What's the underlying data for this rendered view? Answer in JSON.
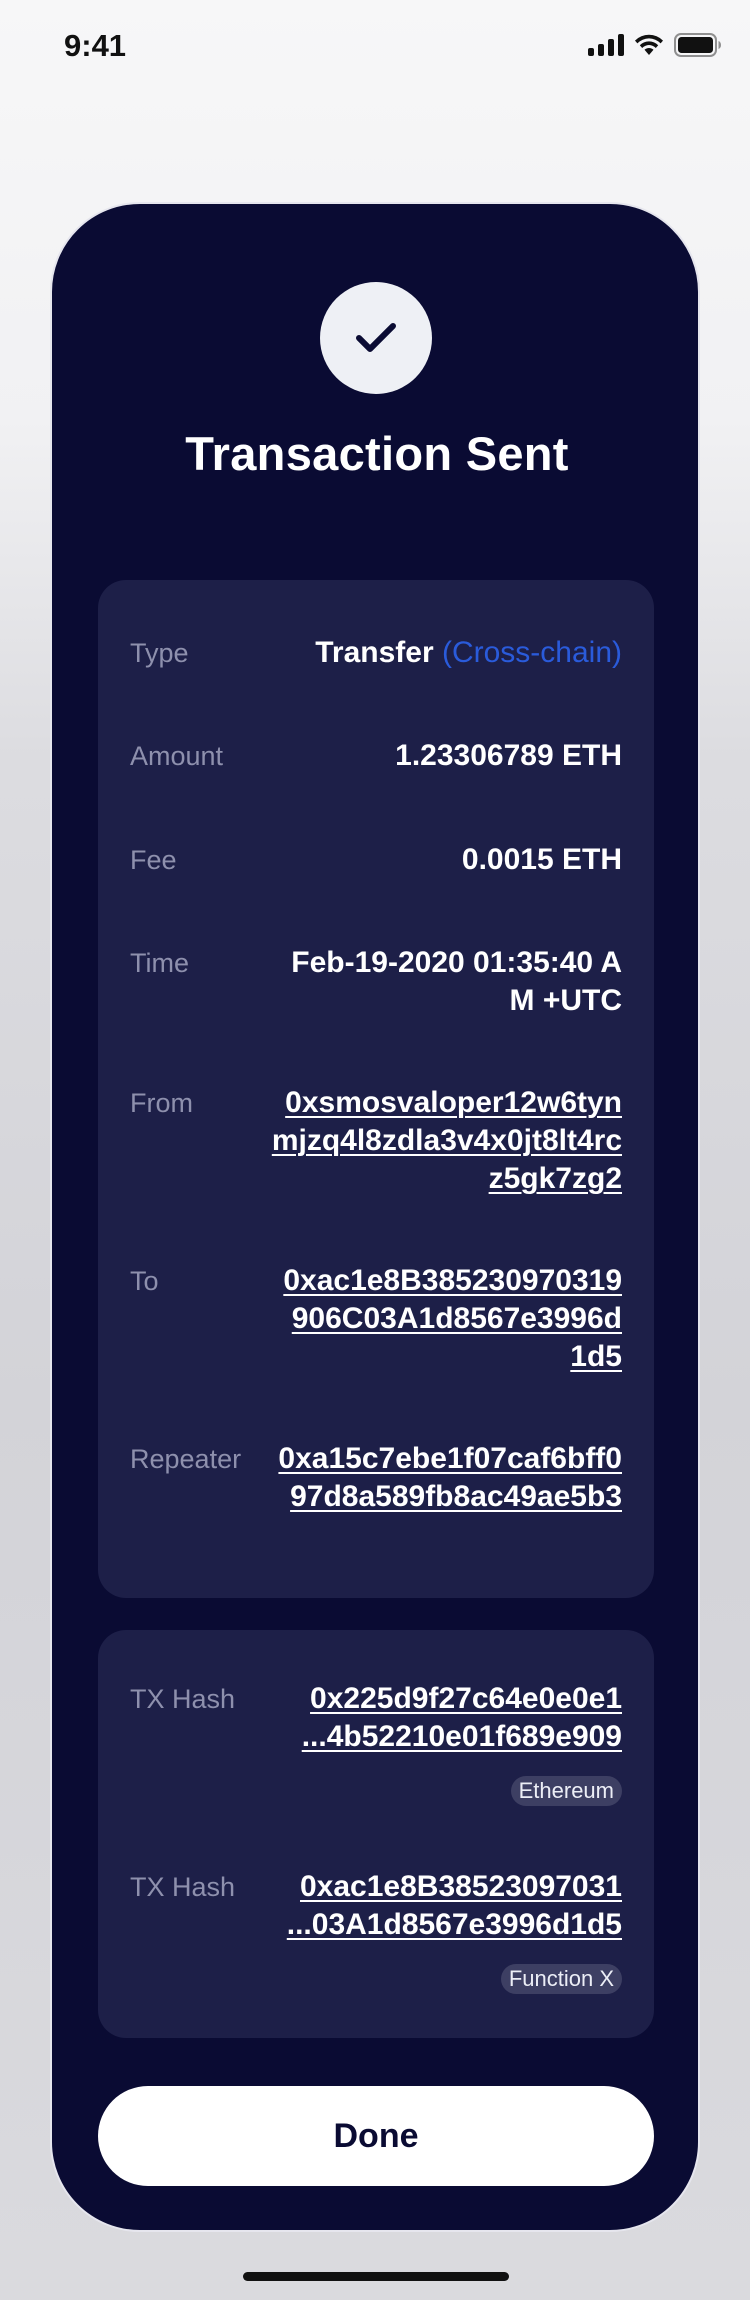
{
  "status_bar": {
    "time": "9:41"
  },
  "title": "Transaction Sent",
  "details": {
    "type": {
      "label": "Type",
      "value": "Transfer",
      "accent": "(Cross-chain)"
    },
    "amount": {
      "label": "Amount",
      "value": "1.23306789 ETH"
    },
    "fee": {
      "label": "Fee",
      "value": "0.0015 ETH"
    },
    "time": {
      "label": "Time",
      "value": "Feb-19-2020 01:35:40 AM +UTC"
    },
    "from": {
      "label": "From",
      "value": "0xsmosvaloper12w6tynmjzq4l8zdla3v4x0jt8lt4rcz5gk7zg2"
    },
    "to": {
      "label": "To",
      "value": "0xac1e8B385230970319906C03A1d8567e3996d1d5"
    },
    "repeater": {
      "label": "Repeater",
      "value": "0xa15c7ebe1f07caf6bff097d8a589fb8ac49ae5b3"
    }
  },
  "hashes": [
    {
      "label": "TX Hash",
      "line1": "0x225d9f27c64e0e0e1",
      "line2": "...4b52210e01f689e909",
      "network": "Ethereum"
    },
    {
      "label": "TX Hash",
      "line1": "0xac1e8B38523097031",
      "line2": "...03A1d8567e3996d1d5",
      "network": "Function X"
    }
  ],
  "done_label": "Done",
  "colors": {
    "card_background": "#0a0b33",
    "panel_background": "#1d1f48",
    "accent": "#2a5bdb",
    "label": "#8e90ad"
  },
  "icons": [
    "signal-icon",
    "wifi-icon",
    "battery-icon",
    "check-icon"
  ]
}
